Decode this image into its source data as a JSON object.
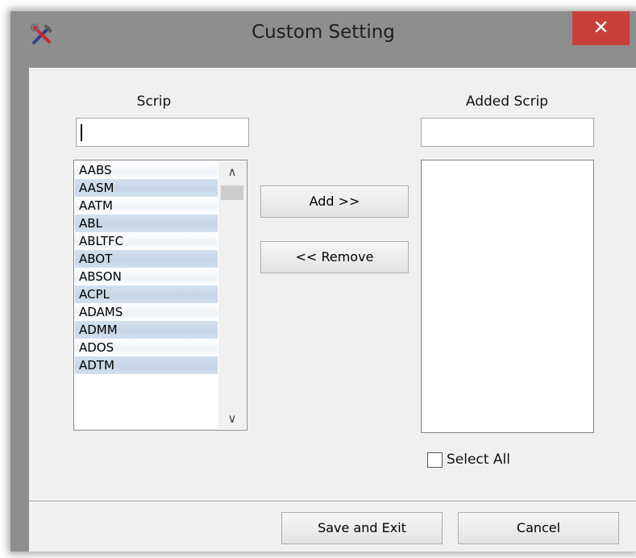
{
  "window": {
    "title": "Custom Setting",
    "close_glyph": "✕",
    "accent_close": "#c8403a",
    "app_icon": "tools-icon"
  },
  "scrip_panel": {
    "label": "Scrip",
    "search_value": "",
    "items": [
      "AABS",
      "AASM",
      "AATM",
      "ABL",
      "ABLTFC",
      "ABOT",
      "ABSON",
      "ACPL",
      "ADAMS",
      "ADMM",
      "ADOS",
      "ADTM"
    ]
  },
  "added_panel": {
    "label": "Added Scrip",
    "search_value": "",
    "items": []
  },
  "actions": {
    "add_label": "Add >>",
    "remove_label": "<< Remove"
  },
  "select_all": {
    "label": "Select All",
    "checked": false
  },
  "footer": {
    "save_label": "Save and Exit",
    "cancel_label": "Cancel"
  }
}
